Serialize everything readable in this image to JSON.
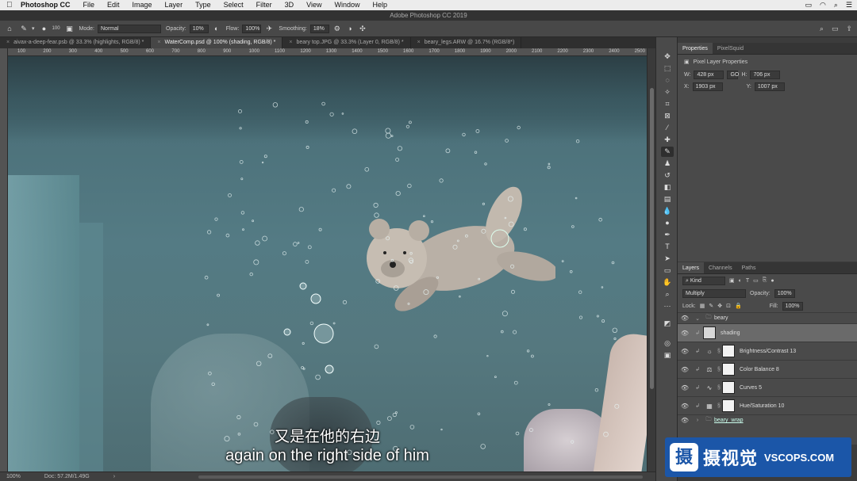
{
  "menubar": {
    "app": "Photoshop CC",
    "items": [
      "File",
      "Edit",
      "Image",
      "Layer",
      "Type",
      "Select",
      "Filter",
      "3D",
      "View",
      "Window",
      "Help"
    ]
  },
  "window_title": "Adobe Photoshop CC 2019",
  "options": {
    "mode_label": "Mode:",
    "mode_value": "Normal",
    "opacity_label": "Opacity:",
    "opacity_value": "10%",
    "flow_label": "Flow:",
    "flow_value": "100%",
    "smoothing_label": "Smoothing:",
    "smoothing_value": "18%",
    "brush_size": "100"
  },
  "tabs": [
    {
      "label": "aivax-a-deep-fear.psb @ 33.3% (highlights, RGB/8) *",
      "active": false
    },
    {
      "label": "WaterComp.psd @ 100% (shading, RGB/8) *",
      "active": true
    },
    {
      "label": "beary top.JPG @ 33.3% (Layer 0, RGB/8) *",
      "active": false
    },
    {
      "label": "beary_legs.ARW @ 16.7% (RGB/8*)",
      "active": false
    }
  ],
  "ruler_ticks": [
    "100",
    "200",
    "300",
    "400",
    "500",
    "600",
    "700",
    "800",
    "900",
    "1000",
    "1100",
    "1200",
    "1300",
    "1400",
    "1500",
    "1600",
    "1700",
    "1800",
    "1900",
    "2000",
    "2100",
    "2200",
    "2300",
    "2400",
    "2500"
  ],
  "subtitles": {
    "cn": "又是在他的右边",
    "en": "again on the right side of him"
  },
  "statusbar": {
    "zoom": "100%",
    "doc": "Doc: 57.2M/1.49G"
  },
  "properties": {
    "tabs": [
      "Properties",
      "PixelSquid"
    ],
    "subtitle": "Pixel Layer Properties",
    "w_label": "W:",
    "w_value": "428 px",
    "h_label": "H:",
    "h_value": "706 px",
    "link": "GO",
    "x_label": "X:",
    "x_value": "1903 px",
    "y_label": "Y:",
    "y_value": "1007 px"
  },
  "layers": {
    "tabs": [
      "Layers",
      "Channels",
      "Paths"
    ],
    "kind": "Kind",
    "blend": "Multiply",
    "opacity_label": "Opacity:",
    "opacity_value": "100%",
    "lock_label": "Lock:",
    "fill_label": "Fill:",
    "fill_value": "100%",
    "group": "beary",
    "rows": [
      {
        "name": "shading",
        "selected": true,
        "thumb": "pixel"
      },
      {
        "name": "Brightness/Contrast 13",
        "selected": false,
        "icon": "☼"
      },
      {
        "name": "Color Balance 8",
        "selected": false,
        "icon": "⚖"
      },
      {
        "name": "Curves 5",
        "selected": false,
        "icon": "∿"
      },
      {
        "name": "Hue/Saturation 10",
        "selected": false,
        "icon": "▦"
      }
    ],
    "subgroup": "beary_wrap"
  },
  "watermark": {
    "logo": "摄",
    "cn": "摄视觉",
    "en": "VSCOPS.COM"
  },
  "colors": {
    "accent": "#1b56a8",
    "canvas_water": "#547b84"
  }
}
